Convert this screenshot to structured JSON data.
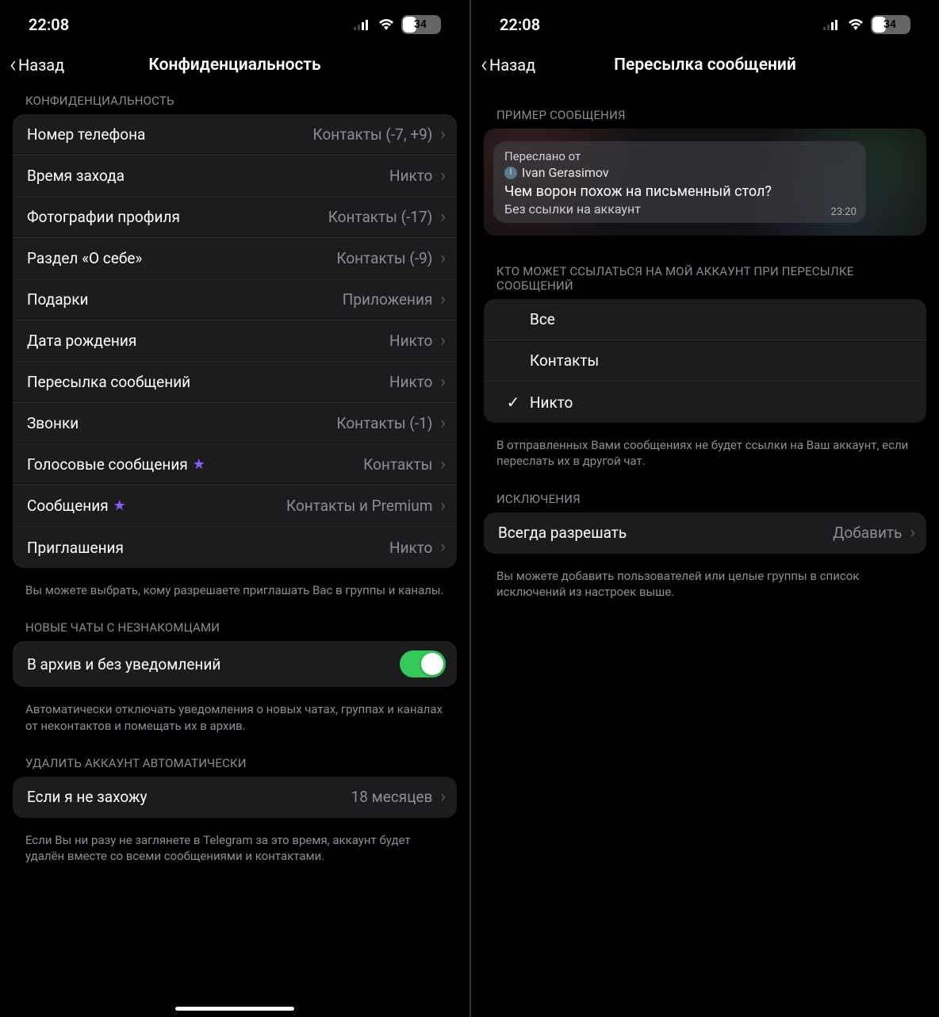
{
  "status": {
    "time": "22:08",
    "battery": "34"
  },
  "left": {
    "back": "Назад",
    "title": "Конфиденциальность",
    "section_privacy": "КОНФИДЕНЦИАЛЬНОСТЬ",
    "rows": {
      "phone": {
        "label": "Номер телефона",
        "value": "Контакты (-7, +9)"
      },
      "lastseen": {
        "label": "Время захода",
        "value": "Никто"
      },
      "photos": {
        "label": "Фотографии профиля",
        "value": "Контакты (-17)"
      },
      "bio": {
        "label": "Раздел «О себе»",
        "value": "Контакты (-9)"
      },
      "gifts": {
        "label": "Подарки",
        "value": "Приложения"
      },
      "birthday": {
        "label": "Дата рождения",
        "value": "Никто"
      },
      "forward": {
        "label": "Пересылка сообщений",
        "value": "Никто"
      },
      "calls": {
        "label": "Звонки",
        "value": "Контакты (-1)"
      },
      "voice": {
        "label": "Голосовые сообщения",
        "value": "Контакты"
      },
      "messages": {
        "label": "Сообщения",
        "value": "Контакты и Premium"
      },
      "invites": {
        "label": "Приглашения",
        "value": "Никто"
      }
    },
    "footer1": "Вы можете выбрать, кому разрешаете приглашать Вас в группы и каналы.",
    "section_newchats": "НОВЫЕ ЧАТЫ С НЕЗНАКОМЦАМИ",
    "archive_label": "В архив и без уведомлений",
    "footer2": "Автоматически отключать уведомления о новых чатах, группах и каналах от неконтактов и помещать их в архив.",
    "section_delete": "УДАЛИТЬ АККАУНТ АВТОМАТИЧЕСКИ",
    "delete_row": {
      "label": "Если я не захожу",
      "value": "18 месяцев"
    },
    "footer3": "Если Вы ни разу не заглянете в Telegram за это время, аккаунт будет удалён вместе со всеми сообщениями и контактами."
  },
  "right": {
    "back": "Назад",
    "title": "Пересылка сообщений",
    "section_example": "ПРИМЕР СООБЩЕНИЯ",
    "msg": {
      "fwd_label": "Переслано от",
      "fwd_name": "Ivan Gerasimov",
      "text": "Чем ворон похож на письменный стол?",
      "sub": "Без ссылки на аккаунт",
      "time": "23:20"
    },
    "section_who": "КТО МОЖЕТ ССЫЛАТЬСЯ НА МОЙ АККАУНТ ПРИ ПЕРЕСЫЛКЕ СООБЩЕНИЙ",
    "options": {
      "all": "Все",
      "contacts": "Контакты",
      "nobody": "Никто"
    },
    "footer1": "В отправленных Вами сообщениях не будет ссылки на Ваш аккаунт, если переслать их в другой чат.",
    "section_except": "ИСКЛЮЧЕНИЯ",
    "except_row": {
      "label": "Всегда разрешать",
      "value": "Добавить"
    },
    "footer2": "Вы можете добавить пользователей или целые группы в список исключений из настроек выше."
  }
}
